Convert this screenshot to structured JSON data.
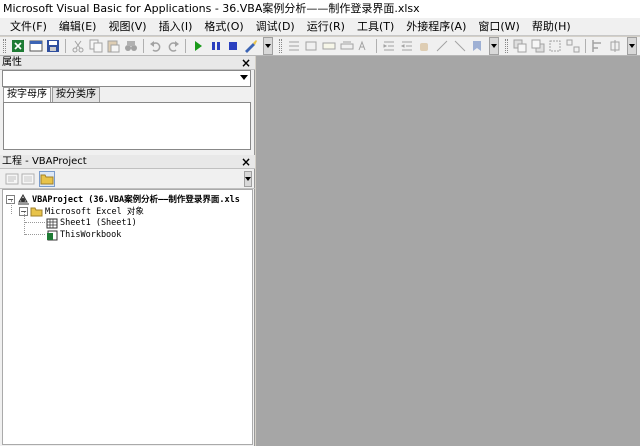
{
  "window": {
    "title": "Microsoft Visual Basic for Applications - 36.VBA案例分析——制作登录界面.xlsx"
  },
  "menu": [
    {
      "label": "文件(F)"
    },
    {
      "label": "编辑(E)"
    },
    {
      "label": "视图(V)"
    },
    {
      "label": "插入(I)"
    },
    {
      "label": "格式(O)"
    },
    {
      "label": "调试(D)"
    },
    {
      "label": "运行(R)"
    },
    {
      "label": "工具(T)"
    },
    {
      "label": "外接程序(A)"
    },
    {
      "label": "窗口(W)"
    },
    {
      "label": "帮助(H)"
    }
  ],
  "properties_panel": {
    "title": "属性",
    "close_label": "×",
    "object_combo_value": "",
    "tabs": [
      {
        "label": "按字母序",
        "active": true
      },
      {
        "label": "按分类序",
        "active": false
      }
    ]
  },
  "project_panel": {
    "title": "工程 - VBAProject",
    "close_label": "×",
    "tree": {
      "root_label": "VBAProject (36.VBA案例分析——制作登录界面.xls",
      "root_expander": "−",
      "folder_label": "Microsoft Excel 对象",
      "folder_expander": "−",
      "items": [
        {
          "label": "Sheet1 (Sheet1)",
          "icon": "worksheet-icon"
        },
        {
          "label": "ThisWorkbook",
          "icon": "workbook-icon"
        }
      ]
    }
  },
  "colors": {
    "workspace": "#a6a6a6",
    "run_green": "#1a9a1a",
    "stop_blue": "#2a3fbf",
    "folder_yellow": "#e8c34a"
  }
}
